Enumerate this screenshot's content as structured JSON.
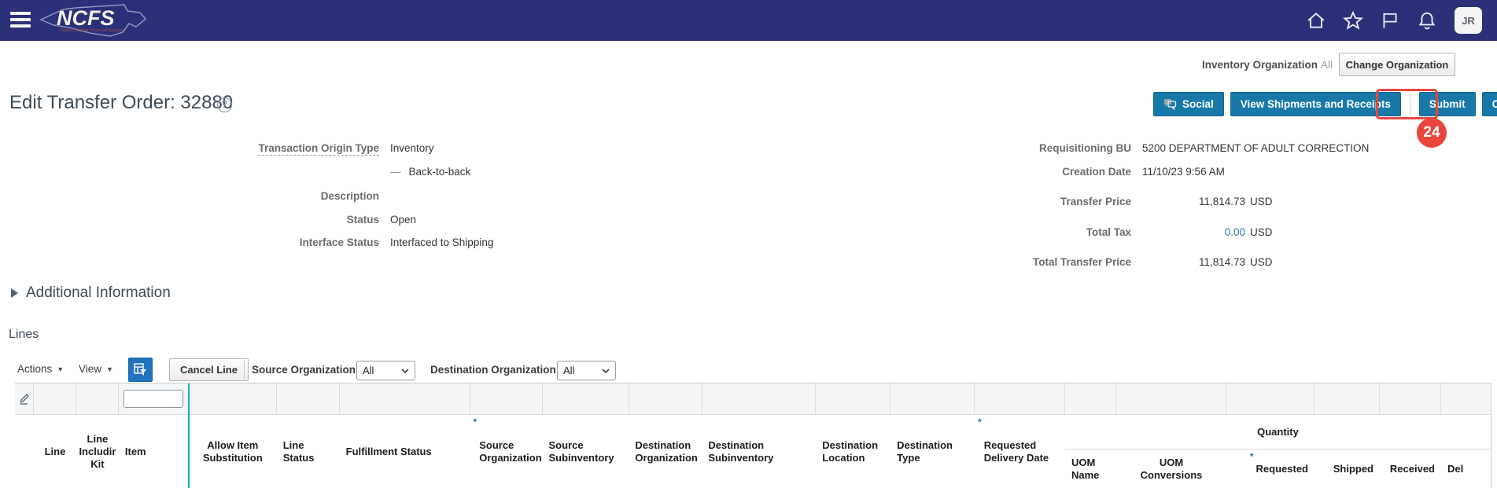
{
  "navbar": {
    "logo_text": "NCFS",
    "logo_subtext": "North Carolina Financial System",
    "avatar_initials": "JR"
  },
  "org_bar": {
    "label": "Inventory Organization",
    "value": "All",
    "change_button": "Change Organization"
  },
  "page": {
    "title": "Edit Transfer Order: 32880"
  },
  "action_buttons": {
    "social": "Social",
    "view_shipments": "View Shipments and Receipts",
    "submit": "Submit",
    "cancel": "Cancel",
    "annotation_badge": "24"
  },
  "details": {
    "left": [
      {
        "label": "Transaction Origin Type",
        "value": "Inventory"
      },
      {
        "label": "",
        "prefix": "—",
        "value": "Back-to-back"
      },
      {
        "label": "Description",
        "value": ""
      },
      {
        "label": "Status",
        "value": "Open"
      },
      {
        "label": "Interface Status",
        "value": "Interfaced to Shipping"
      }
    ],
    "right": [
      {
        "label": "Requisitioning BU",
        "value": "5200 DEPARTMENT OF ADULT CORRECTION",
        "currency": ""
      },
      {
        "label": "Creation Date",
        "value": "11/10/23 9:56 AM",
        "currency": ""
      },
      {
        "label": "Transfer Price",
        "value": "11,814.73",
        "currency": "USD"
      },
      {
        "label": "Total Tax",
        "value": "0.00",
        "currency": "USD"
      },
      {
        "label": "Total Transfer Price",
        "value": "11,814.73",
        "currency": "USD"
      }
    ]
  },
  "sections": {
    "additional_information": "Additional Information",
    "lines": "Lines"
  },
  "lines_toolbar": {
    "actions": "Actions",
    "view": "View",
    "cancel_line": "Cancel Line",
    "source_org_label": "Source Organization",
    "source_org_value": "All",
    "dest_org_label": "Destination Organization",
    "dest_org_value": "All"
  },
  "table": {
    "required_marker": "*",
    "quantity_group": "Quantity",
    "columns": [
      {
        "label": "Line"
      },
      {
        "label": "Line\nIncludir\nKit"
      },
      {
        "label": "Item"
      },
      {
        "label": "Allow Item\nSubstitution"
      },
      {
        "label": "Line\nStatus"
      },
      {
        "label": "Fulfillment Status"
      },
      {
        "label": "Source\nOrganization",
        "required": true
      },
      {
        "label": "Source\nSubinventory"
      },
      {
        "label": "Destination\nOrganization"
      },
      {
        "label": "Destination\nSubinventory"
      },
      {
        "label": "Destination\nLocation"
      },
      {
        "label": "Destination\nType"
      },
      {
        "label": "Requested\nDelivery Date",
        "required": true
      },
      {
        "label": "UOM\nName"
      },
      {
        "label": "UOM\nConversions"
      },
      {
        "label": "Requested",
        "required": true
      },
      {
        "label": "Shipped"
      },
      {
        "label": "Received"
      },
      {
        "label": "Del"
      }
    ]
  },
  "colors": {
    "navbar": "#2c3079",
    "button_blue": "#1879a8",
    "annotation_red": "#e8463d",
    "splitter_teal": "#14b3c6",
    "link_blue": "#3073af"
  }
}
